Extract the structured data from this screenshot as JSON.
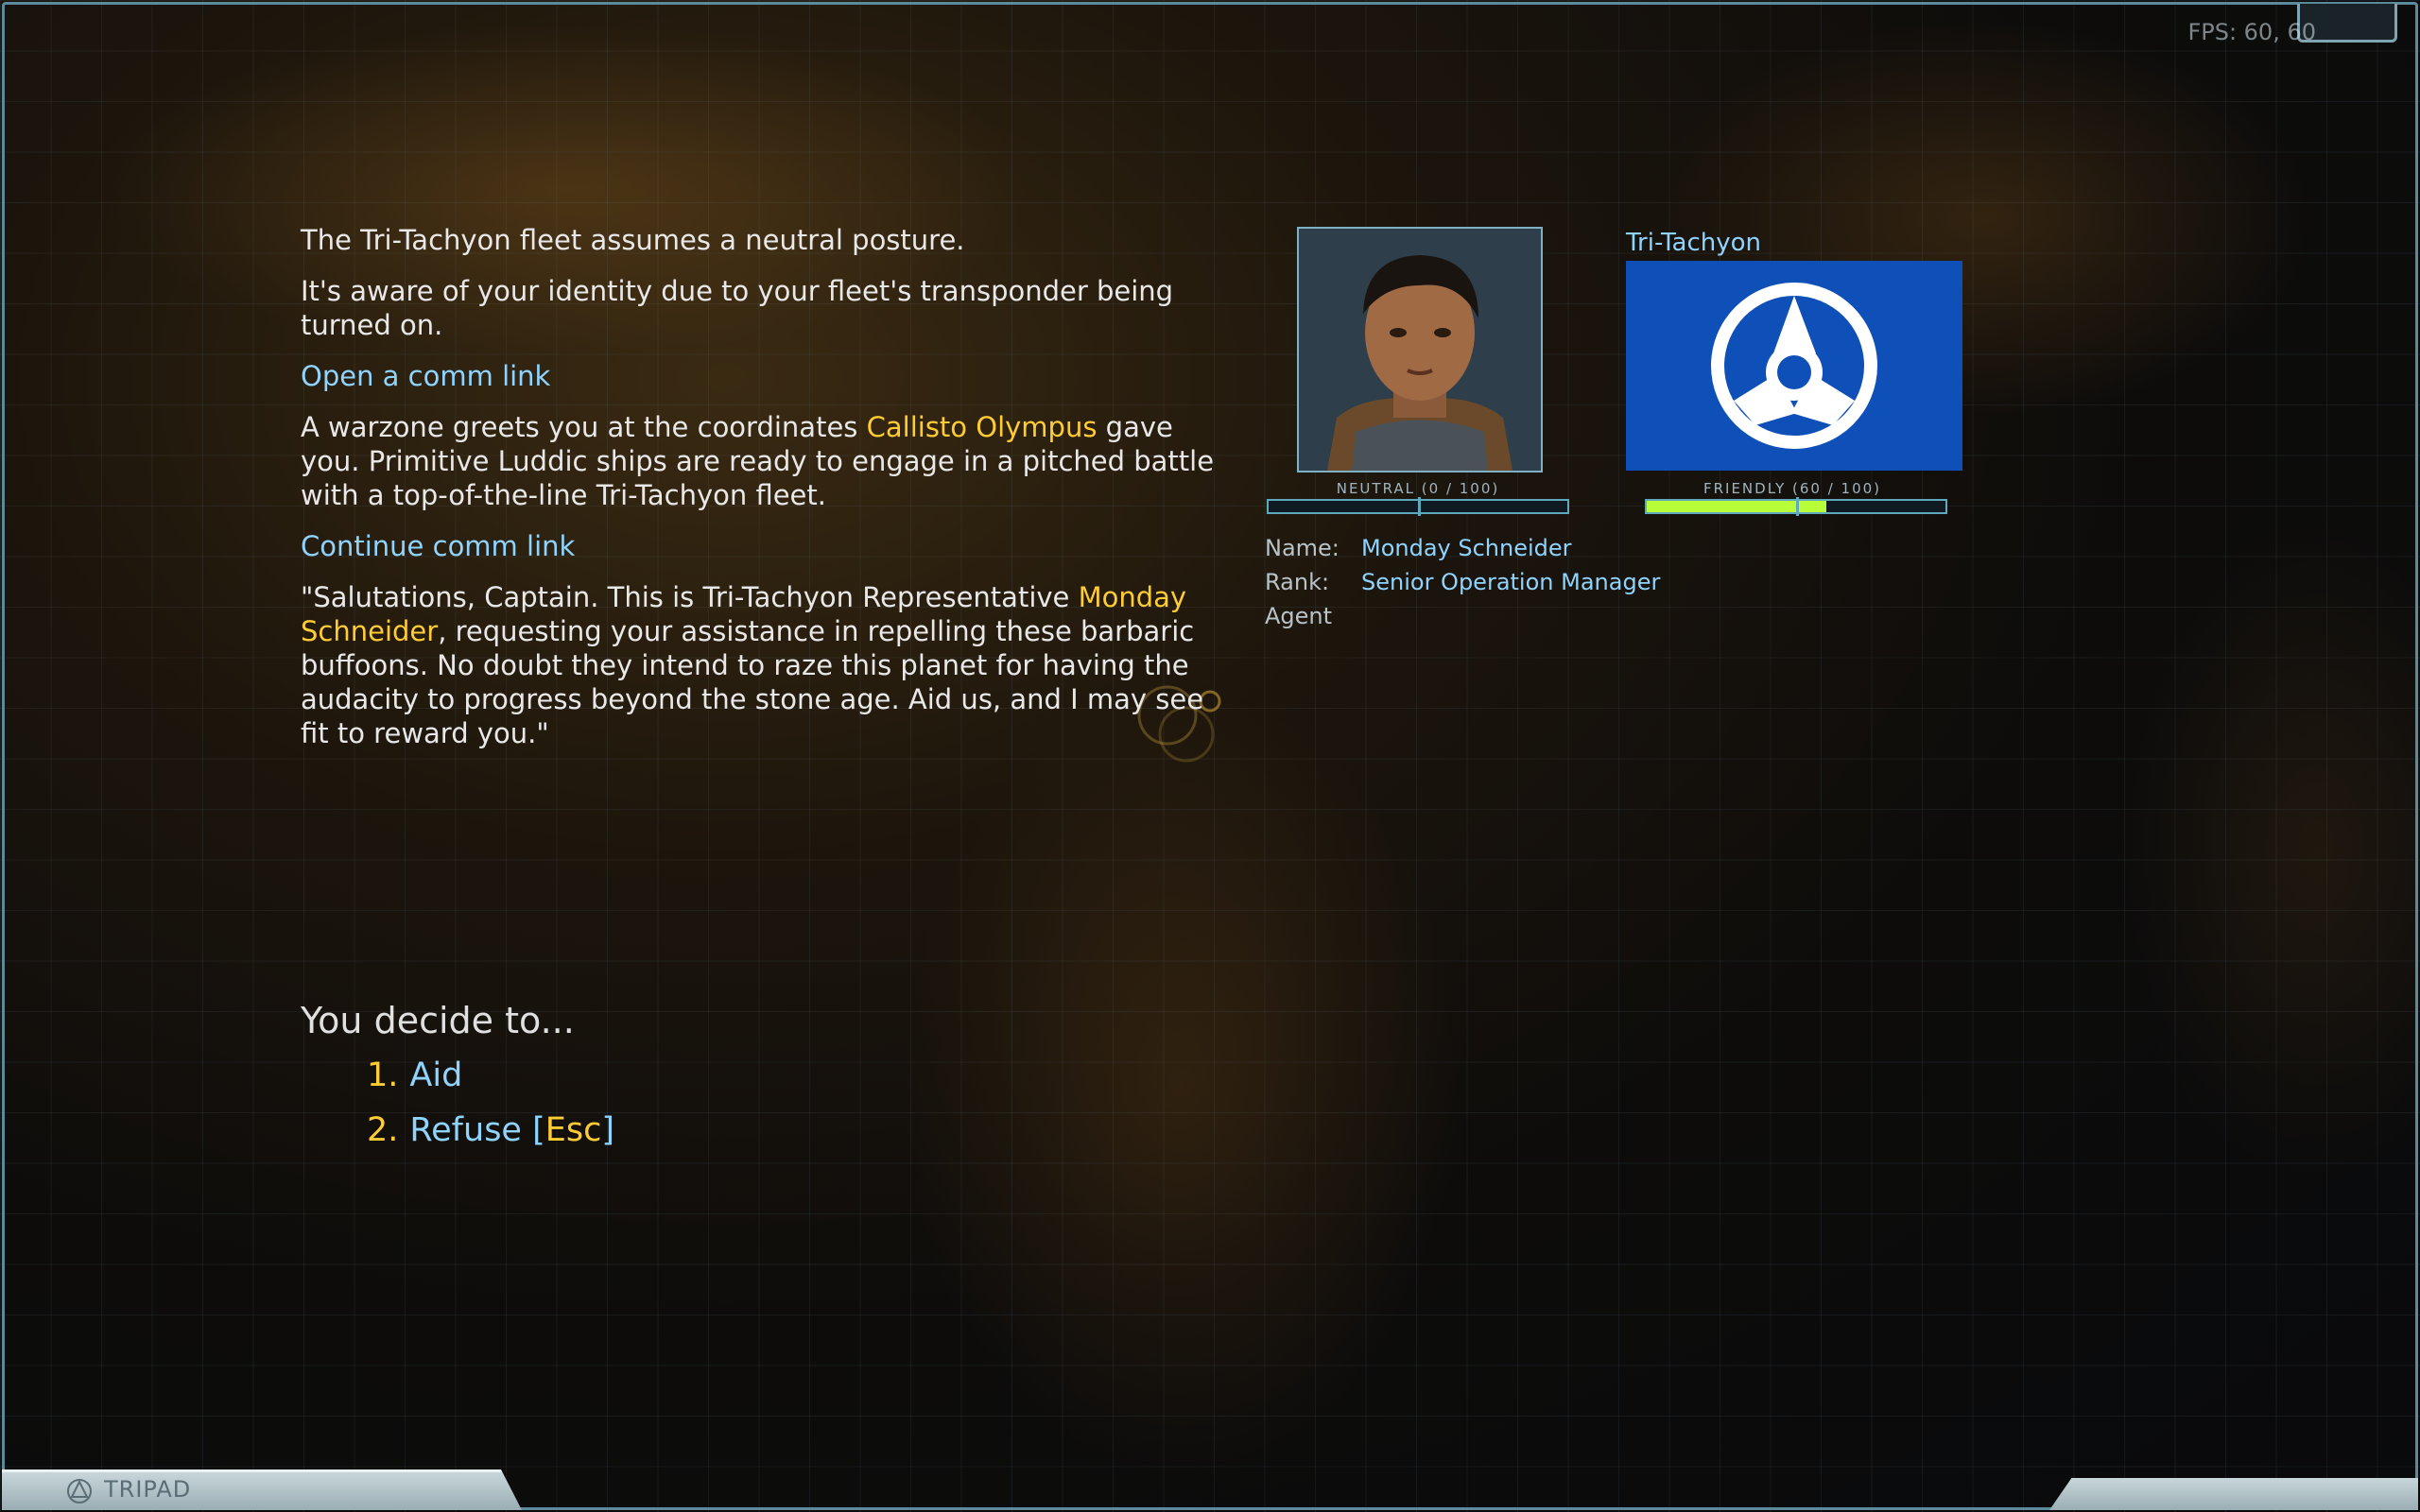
{
  "hud": {
    "fps_label": "FPS: 60, 60"
  },
  "dialog": {
    "paragraphs": {
      "p1": "The Tri-Tachyon fleet assumes a neutral posture.",
      "p2": "It's aware of your identity due to your fleet's transponder being turned on."
    },
    "link_open": "Open a comm link",
    "p3": {
      "before": "A warzone greets you at the coordinates ",
      "highlight": "Callisto Olympus",
      "after": " gave you. Primitive Luddic ships are ready to engage in a pitched battle with a top-of-the-line Tri-Tachyon fleet."
    },
    "link_continue": "Continue comm link",
    "p4": {
      "before": "\"Salutations, Captain. This is Tri-Tachyon Representative ",
      "highlight": "Monday Schneider",
      "after": ", requesting your assistance in repelling these barbaric buffoons. No doubt they intend to raze this planet for having the audacity to progress beyond the stone age. Aid us, and I may see fit to reward you.\""
    }
  },
  "decision": {
    "prompt": "You decide to...",
    "options": [
      {
        "num": "1.",
        "label": "Aid",
        "key": ""
      },
      {
        "num": "2.",
        "label": "Refuse [",
        "key": "Esc",
        "suffix": "]"
      }
    ]
  },
  "person": {
    "relation_label": "NEUTRAL (0 / 100)",
    "relation_value": 0,
    "name_label": "Name:",
    "name": "Monday Schneider",
    "rank_label": "Rank:",
    "rank": "Senior Operation Manager",
    "post": "Agent"
  },
  "faction": {
    "name": "Tri-Tachyon",
    "relation_label": "FRIENDLY (60 / 100)",
    "relation_value": 60,
    "flag_color": "#0f4fb8"
  },
  "footer": {
    "brand": "TRIPAD"
  }
}
